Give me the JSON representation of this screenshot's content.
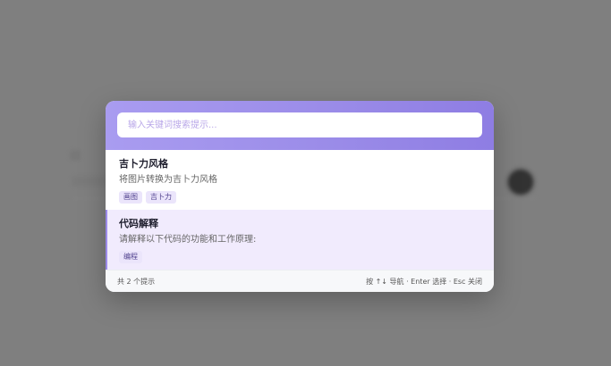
{
  "search": {
    "placeholder": "输入关键词搜索提示..."
  },
  "results": [
    {
      "title": "吉卜力风格",
      "description": "将图片转换为吉卜力风格",
      "tags": [
        "画图",
        "吉卜力"
      ],
      "active": false
    },
    {
      "title": "代码解释",
      "description": "请解释以下代码的功能和工作原理:",
      "tags": [
        "编程"
      ],
      "active": true
    }
  ],
  "footer": {
    "count_text": "共 2 个提示",
    "hint_text": "按 ↑↓ 导航 · Enter 选择 · Esc 关闭"
  },
  "colors": {
    "header_gradient_start": "#a99cf0",
    "header_gradient_end": "#8e7de3",
    "active_item_bg": "#f1ebfd",
    "tag_bg": "#ebe5fb",
    "overlay": "#7f7f7f"
  }
}
